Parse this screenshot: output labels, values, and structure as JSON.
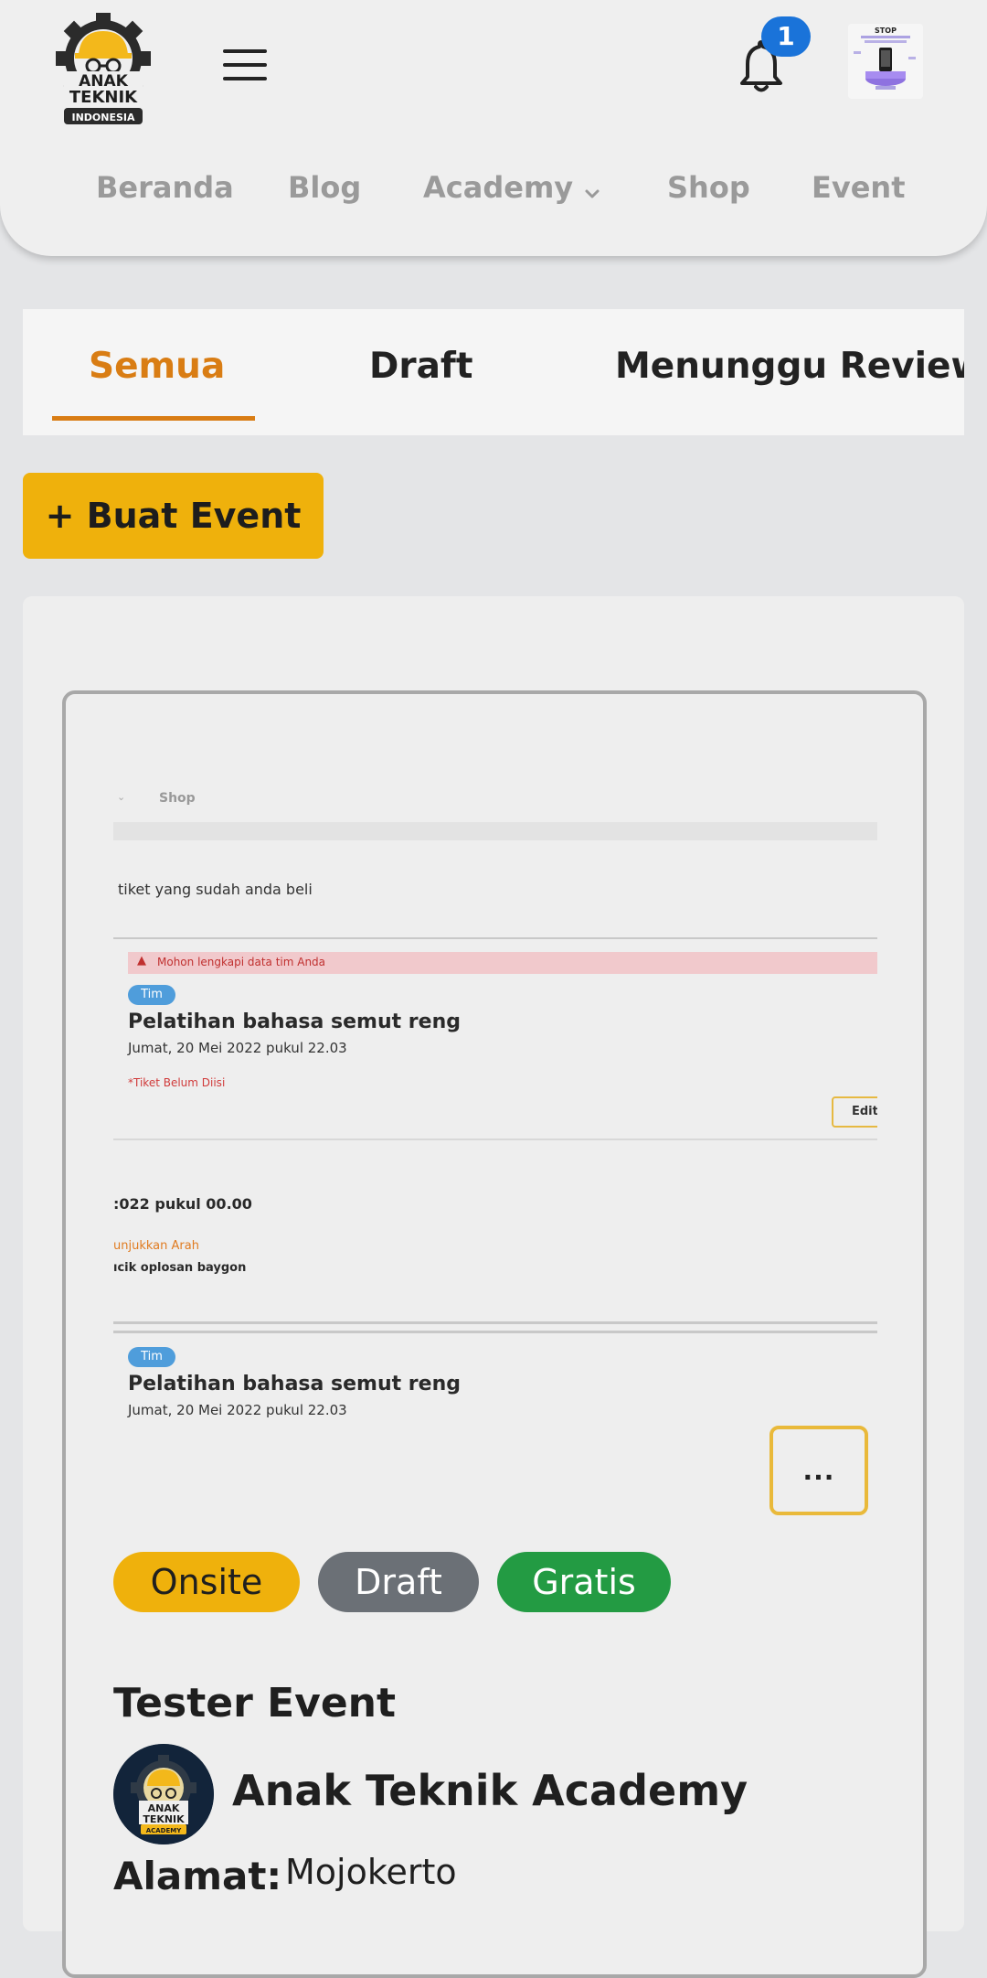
{
  "header": {
    "logo_text": [
      "ANAK",
      "TEKNIK",
      "INDONESIA"
    ],
    "notification_count": "1",
    "nav": {
      "home": "Beranda",
      "blog": "Blog",
      "academy": "Academy",
      "shop": "Shop",
      "event": "Event"
    },
    "thumb_text": "STOP"
  },
  "tabs": {
    "all": "Semua",
    "draft": "Draft",
    "review": "Menunggu Review",
    "active": "all"
  },
  "create_button": "+ Buat Event",
  "card": {
    "preview": {
      "nav_shop": "Shop",
      "tickets_text": "tiket yang sudah anda beli",
      "alert": "Mohon lengkapi data tim Anda",
      "tag": "Tim",
      "event_title_1": "Pelatihan bahasa semut reng",
      "event_date_1": "Jumat, 20 Mei 2022 pukul 22.03",
      "ticket_note": "*Tiket Belum Diisi",
      "edit_btn": "Edit",
      "date_2": ":022 pukul 00.00",
      "directions": "unjukkan Arah",
      "address_2": "ıcik oplosan baygon",
      "tag_2": "Tim",
      "event_title_2": "Pelatihan bahasa semut reng",
      "event_date_2": "Jumat, 20 Mei 2022 pukul 22.03"
    },
    "more_label": "...",
    "badges": {
      "onsite": "Onsite",
      "draft": "Draft",
      "free": "Gratis"
    },
    "title": "Tester Event",
    "organizer": "Anak Teknik Academy",
    "address_label": "Alamat:",
    "address_value": "Mojokerto"
  },
  "colors": {
    "accent": "#d97d14",
    "primary_button": "#efb10c",
    "badge_onsite": "#efb10c",
    "badge_draft": "#6b7076",
    "badge_free": "#239b43",
    "notification": "#1a73d9"
  }
}
